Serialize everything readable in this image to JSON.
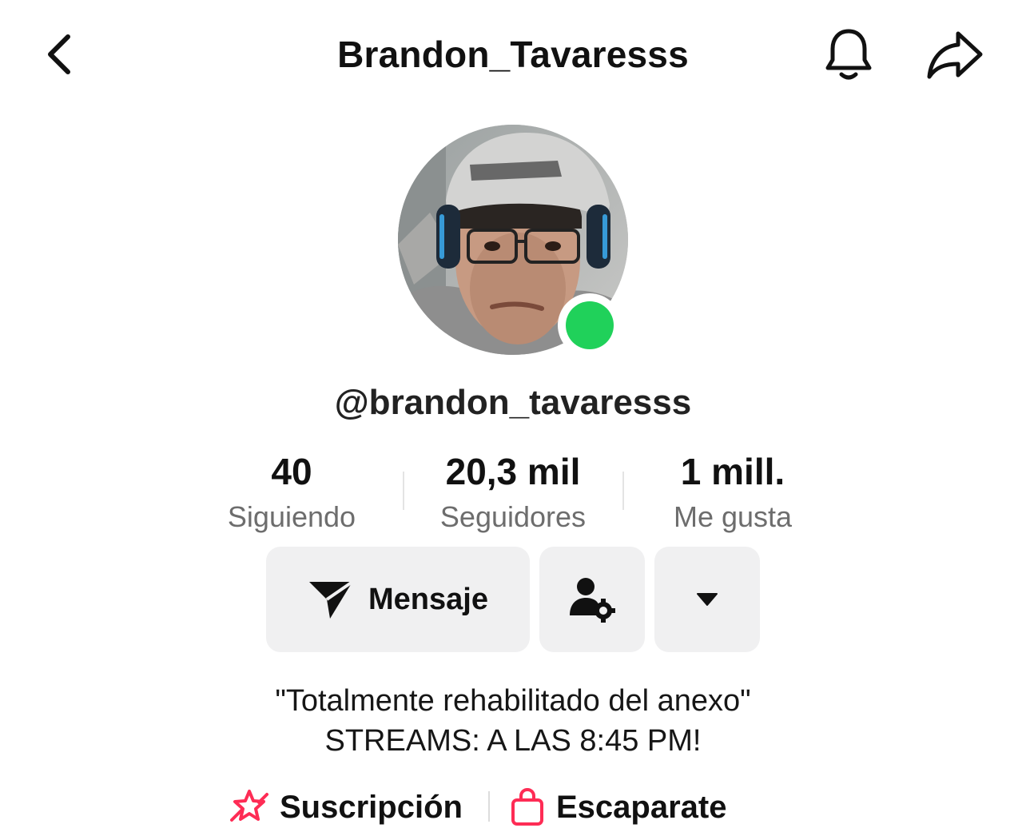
{
  "header": {
    "title": "Brandon_Tavaresss",
    "back_icon": "chevron-left-icon",
    "bell_icon": "bell-icon",
    "share_icon": "share-arrow-icon"
  },
  "profile": {
    "handle": "@brandon_tavaresss",
    "online_status_color": "#20d15a"
  },
  "stats": [
    {
      "value": "40",
      "label": "Siguiendo"
    },
    {
      "value": "20,3 mil",
      "label": "Seguidores"
    },
    {
      "value": "1 mill.",
      "label": "Me gusta"
    }
  ],
  "actions": {
    "message_label": "Mensaje",
    "message_icon": "send-plane-icon",
    "friend_settings_icon": "person-gear-icon",
    "more_icon": "caret-down-icon"
  },
  "bio": {
    "line1": "\"Totalmente rehabilitado del anexo\"",
    "line2": "STREAMS: A LAS 8:45 PM!"
  },
  "links": {
    "subscription_label": "Suscripción",
    "subscription_icon": "star-ribbon-icon",
    "storefront_label": "Escaparate",
    "storefront_icon": "shopping-bag-icon",
    "accent_color": "#fe2c55"
  }
}
